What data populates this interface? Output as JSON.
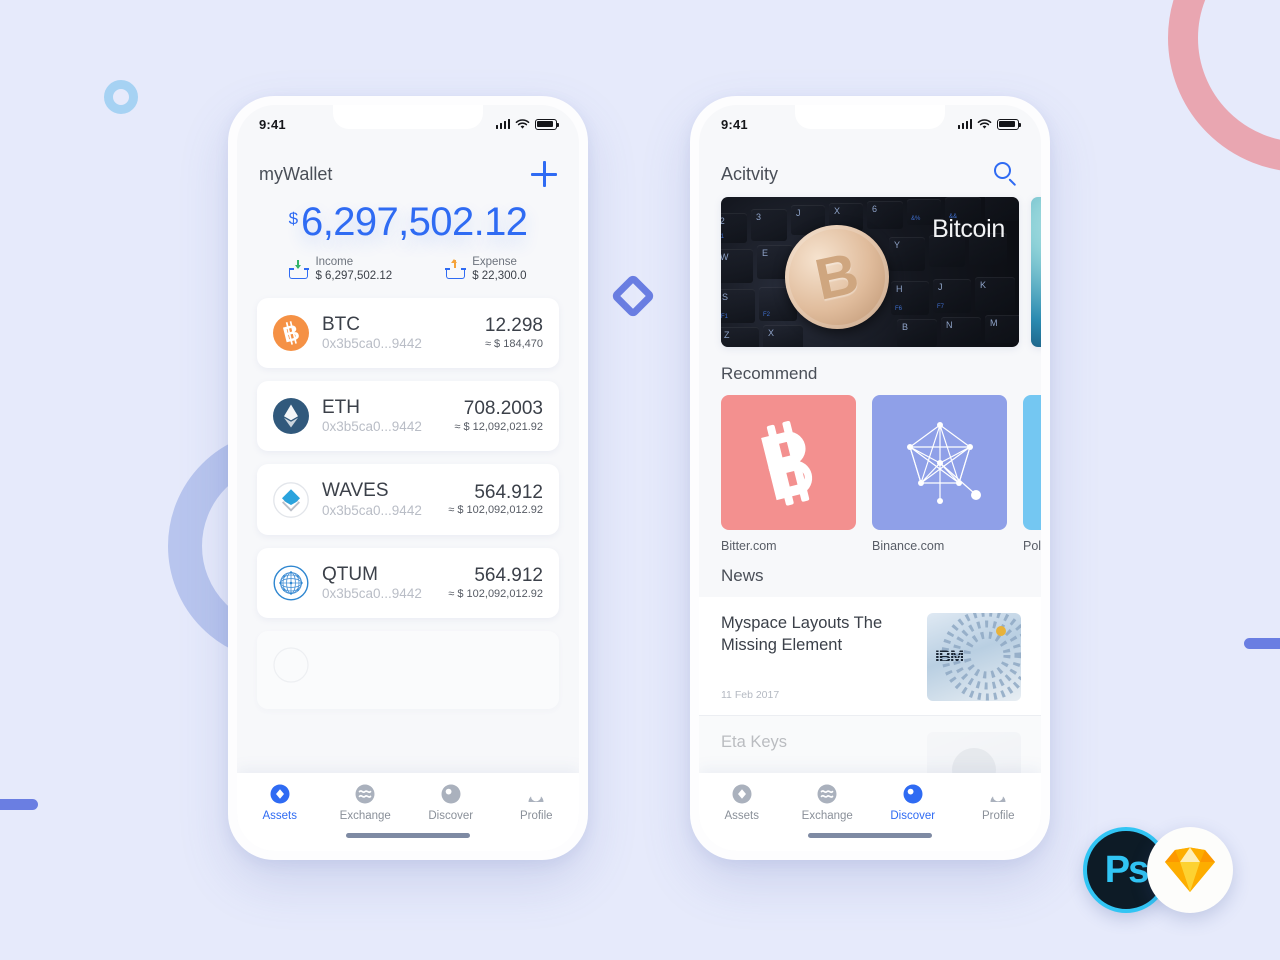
{
  "background": {
    "color": "#e6eafb",
    "decorations": [
      {
        "name": "ring-pink",
        "color": "#e9a6b1"
      },
      {
        "name": "ring-periwinkle",
        "color": "#b8c5ee"
      },
      {
        "name": "ring-skyblue",
        "color": "#a6d2f3"
      },
      {
        "name": "diamond",
        "color": "#6a7ee2"
      },
      {
        "name": "pill-left",
        "color": "#6a7ee2"
      },
      {
        "name": "pill-right",
        "color": "#6a7ee2"
      }
    ]
  },
  "accent": "#2f6bf3",
  "status_bar": {
    "time": "9:41"
  },
  "wallet_screen": {
    "title": "myWallet",
    "add_button": "+",
    "balance": {
      "currency": "$",
      "amount": "6,297,502.12"
    },
    "income": {
      "label": "Income",
      "value": "$ 6,297,502.12",
      "arrow_color": "#35b46a"
    },
    "expense": {
      "label": "Expense",
      "value": "$ 22,300.0",
      "arrow_color": "#f5a33a"
    },
    "assets": [
      {
        "icon": "btc-icon",
        "symbol": "BTC",
        "address": "0x3b5ca0...9442",
        "qty": "12.298",
        "usd": "≈ $ 184,470",
        "color": "#f59145"
      },
      {
        "icon": "eth-icon",
        "symbol": "ETH",
        "address": "0x3b5ca0...9442",
        "qty": "708.2003",
        "usd": "≈ $ 12,092,021.92",
        "color": "#31597c"
      },
      {
        "icon": "waves-icon",
        "symbol": "WAVES",
        "address": "0x3b5ca0...9442",
        "qty": "564.912",
        "usd": "≈ $ 102,092,012.92",
        "color": "#2aa3dd"
      },
      {
        "icon": "qtum-icon",
        "symbol": "QTUM",
        "address": "0x3b5ca0...9442",
        "qty": "564.912",
        "usd": "≈ $ 102,092,012.92",
        "color": "#2e86d0"
      }
    ],
    "tabs": [
      {
        "label": "Assets",
        "icon": "assets-icon",
        "active": true
      },
      {
        "label": "Exchange",
        "icon": "exchange-icon",
        "active": false
      },
      {
        "label": "Discover",
        "icon": "discover-icon",
        "active": false
      },
      {
        "label": "Profile",
        "icon": "profile-icon",
        "active": false
      }
    ]
  },
  "discover_screen": {
    "title": "Acitvity",
    "search_icon": "search-icon",
    "hero_cards": [
      {
        "caption": "Bitcoin",
        "kind": "bitcoin-keyboard-photo"
      },
      {
        "caption": "",
        "kind": "teal-abstract-photo"
      }
    ],
    "recommend": {
      "heading": "Recommend",
      "items": [
        {
          "name": "Bitter.com",
          "color": "#f3908f",
          "logo": "bitcoin-logo"
        },
        {
          "name": "Binance.com",
          "color": "#8fa0e8",
          "logo": "network-logo"
        },
        {
          "name": "Poloni",
          "color": "#74c7f2",
          "logo": "poloniex-logo"
        }
      ]
    },
    "news": {
      "heading": "News",
      "items": [
        {
          "title": "Myspace Layouts The Missing Element",
          "date": "11 Feb 2017",
          "thumb": "ibm-server-thumb"
        },
        {
          "title": "Eta Keys",
          "date": "",
          "thumb": "person-thumb"
        }
      ]
    },
    "tabs": [
      {
        "label": "Assets",
        "icon": "assets-icon",
        "active": false
      },
      {
        "label": "Exchange",
        "icon": "exchange-icon",
        "active": false
      },
      {
        "label": "Discover",
        "icon": "discover-icon",
        "active": true
      },
      {
        "label": "Profile",
        "icon": "profile-icon",
        "active": false
      }
    ]
  },
  "badges": [
    {
      "name": "photoshop-badge",
      "label": "Ps",
      "ring": "#31c5f4",
      "bg": "#0d1b26"
    },
    {
      "name": "sketch-badge",
      "label": "",
      "ring": "#ffffff",
      "bg": "#ffffff"
    }
  ]
}
